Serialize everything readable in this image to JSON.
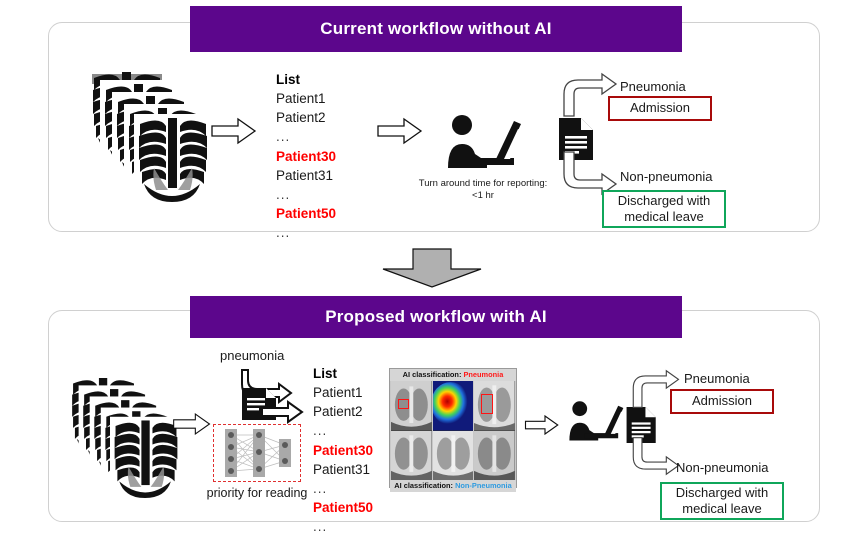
{
  "panels": {
    "top": {
      "title": "Current workflow without AI",
      "turnaround": "Turn around time for reporting: <1 hr"
    },
    "bottom": {
      "title": "Proposed workflow with AI",
      "ai_trigger_label": "pneumonia",
      "priority_label": "priority for reading"
    }
  },
  "patient_list": {
    "title": "List",
    "items": [
      {
        "text": "Patient1",
        "highlight": false
      },
      {
        "text": "Patient2",
        "highlight": false
      },
      {
        "text": "...",
        "highlight": false,
        "ellipsis": true
      },
      {
        "text": "Patient30",
        "highlight": true
      },
      {
        "text": "Patient31",
        "highlight": false
      },
      {
        "text": "...",
        "highlight": false,
        "ellipsis": true
      },
      {
        "text": "Patient50",
        "highlight": true
      },
      {
        "text": "...",
        "highlight": false,
        "ellipsis": true
      }
    ]
  },
  "outcomes": {
    "pneumonia_label": "Pneumonia",
    "pneumonia_action": "Admission",
    "non_pneumonia_label": "Non-pneumonia",
    "non_pneumonia_action": "Discharged with medical leave"
  },
  "ai_classification": {
    "positive_caption_prefix": "AI classification: ",
    "positive_caption_value": "Pneumonia",
    "negative_caption_prefix": "AI classification: ",
    "negative_caption_value": "Non-Pneumonia"
  },
  "colors": {
    "header_purple": "#5c068c",
    "highlight_red": "#ff0000",
    "admission_border": "#a80a0a",
    "discharge_border": "#0fa65a",
    "roi_red": "#ff1414",
    "positive_text": "#ff1b1b",
    "negative_text": "#2f9be0",
    "nn_dashed": "#e03030"
  },
  "icons": {
    "xray_stack": "xray-stack-icon",
    "flow_arrow": "block-arrow-right-icon",
    "radiologist": "radiologist-workstation-icon",
    "report": "report-document-icon",
    "branch_up": "branch-arrow-up-icon",
    "branch_down": "branch-arrow-down-icon",
    "transition": "block-arrow-down-icon",
    "neural_net": "neural-network-icon"
  }
}
